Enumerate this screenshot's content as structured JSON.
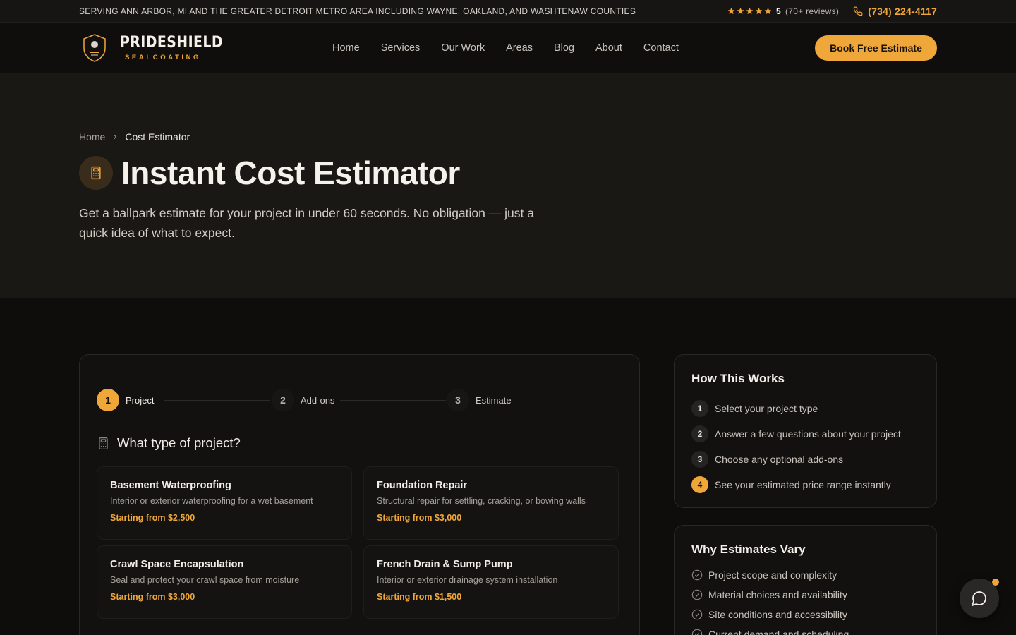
{
  "topbar": {
    "service_area": "SERVING ANN ARBOR, MI AND THE GREATER DETROIT METRO AREA INCLUDING WAYNE, OAKLAND, AND WASHTENAW COUNTIES",
    "rating": "5",
    "review_count": "(70+ reviews)",
    "phone": "(734) 224-4117"
  },
  "header": {
    "brand_name": "PRIDESHIELD",
    "brand_sub": "SEALCOATING",
    "nav": [
      "Home",
      "Services",
      "Our Work",
      "Areas",
      "Blog",
      "About",
      "Contact"
    ],
    "cta": "Book Free Estimate"
  },
  "hero": {
    "breadcrumb_home": "Home",
    "breadcrumb_current": "Cost Estimator",
    "title": "Instant Cost Estimator",
    "subtitle": "Get a ballpark estimate for your project in under 60 seconds. No obligation — just a quick idea of what to expect."
  },
  "estimator": {
    "steps": [
      {
        "num": "1",
        "label": "Project",
        "active": true
      },
      {
        "num": "2",
        "label": "Add-ons",
        "active": false
      },
      {
        "num": "3",
        "label": "Estimate",
        "active": false
      }
    ],
    "question": "What type of project?",
    "options": [
      {
        "title": "Basement Waterproofing",
        "desc": "Interior or exterior waterproofing for a wet basement",
        "price": "Starting from $2,500"
      },
      {
        "title": "Foundation Repair",
        "desc": "Structural repair for settling, cracking, or bowing walls",
        "price": "Starting from $3,000"
      },
      {
        "title": "Crawl Space Encapsulation",
        "desc": "Seal and protect your crawl space from moisture",
        "price": "Starting from $3,000"
      },
      {
        "title": "French Drain & Sump Pump",
        "desc": "Interior or exterior drainage system installation",
        "price": "Starting from $1,500"
      }
    ]
  },
  "how_it_works": {
    "title": "How This Works",
    "items": [
      {
        "num": "1",
        "text": "Select your project type"
      },
      {
        "num": "2",
        "text": "Answer a few questions about your project"
      },
      {
        "num": "3",
        "text": "Choose any optional add-ons"
      },
      {
        "num": "4",
        "text": "See your estimated price range instantly"
      }
    ]
  },
  "why_vary": {
    "title": "Why Estimates Vary",
    "items": [
      "Project scope and complexity",
      "Material choices and availability",
      "Site conditions and accessibility",
      "Current demand and scheduling"
    ]
  },
  "colors": {
    "accent": "#f0a73a",
    "background": "#0e0d0c",
    "hero_background": "#1a1815"
  },
  "icons": {
    "star": "star-icon",
    "phone": "phone-icon",
    "calculator": "calculator-icon",
    "check": "check-circle-icon",
    "chat": "chat-bubble-icon"
  }
}
